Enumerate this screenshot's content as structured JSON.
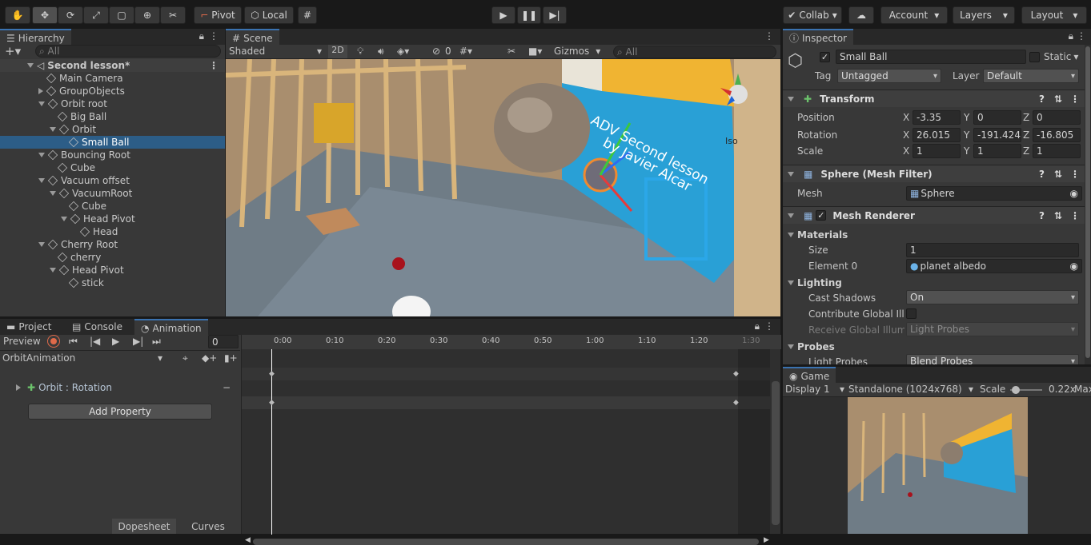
{
  "toolbar": {
    "tools": [
      "hand-tool",
      "move-tool",
      "rotate-tool",
      "scale-tool",
      "rect-tool",
      "transform-tool",
      "custom-tool"
    ],
    "pivot_label": "Pivot",
    "local_label": "Local",
    "collab_label": "Collab",
    "account_label": "Account",
    "layers_label": "Layers",
    "layout_label": "Layout"
  },
  "hierarchy": {
    "tab_label": "Hierarchy",
    "search_placeholder": "All",
    "scene_name": "Second lesson*",
    "items": [
      {
        "label": "Main Camera",
        "depth": 1,
        "arrow": "none"
      },
      {
        "label": "GroupObjects",
        "depth": 1,
        "arrow": "right"
      },
      {
        "label": "Orbit root",
        "depth": 1,
        "arrow": "down"
      },
      {
        "label": "Big Ball",
        "depth": 2,
        "arrow": "none"
      },
      {
        "label": "Orbit",
        "depth": 2,
        "arrow": "down"
      },
      {
        "label": "Small Ball",
        "depth": 3,
        "arrow": "none",
        "selected": true
      },
      {
        "label": "Bouncing Root",
        "depth": 1,
        "arrow": "down"
      },
      {
        "label": "Cube",
        "depth": 2,
        "arrow": "none"
      },
      {
        "label": "Vacuum offset",
        "depth": 1,
        "arrow": "down"
      },
      {
        "label": "VacuumRoot",
        "depth": 2,
        "arrow": "down"
      },
      {
        "label": "Cube",
        "depth": 3,
        "arrow": "none"
      },
      {
        "label": "Head Pivot",
        "depth": 3,
        "arrow": "down"
      },
      {
        "label": "Head",
        "depth": 4,
        "arrow": "none"
      },
      {
        "label": "Cherry Root",
        "depth": 1,
        "arrow": "down"
      },
      {
        "label": "cherry",
        "depth": 2,
        "arrow": "none"
      },
      {
        "label": "Head Pivot",
        "depth": 2,
        "arrow": "down"
      },
      {
        "label": "stick",
        "depth": 3,
        "arrow": "none"
      }
    ]
  },
  "scene": {
    "tab_label": "Scene",
    "shading_mode": "Shaded",
    "mode_2d": "2D",
    "hidden_count": "0",
    "gizmos_label": "Gizmos",
    "search_placeholder": "All",
    "view_label": "Iso",
    "banner_text_1": "ADV Second lesson",
    "banner_text_2": "by Javier Alcar"
  },
  "inspector": {
    "tab_label": "Inspector",
    "object_name": "Small Ball",
    "static_label": "Static",
    "tag_label": "Tag",
    "tag_value": "Untagged",
    "layer_label": "Layer",
    "layer_value": "Default",
    "transform": {
      "title": "Transform",
      "position_label": "Position",
      "rotation_label": "Rotation",
      "scale_label": "Scale",
      "position": {
        "x": "-3.35",
        "y": "0",
        "z": "0"
      },
      "rotation": {
        "x": "26.015",
        "y": "-191.424",
        "z": "-16.805"
      },
      "scale": {
        "x": "1",
        "y": "1",
        "z": "1"
      }
    },
    "mesh_filter": {
      "title": "Sphere (Mesh Filter)",
      "mesh_label": "Mesh",
      "mesh_value": "Sphere"
    },
    "mesh_renderer": {
      "title": "Mesh Renderer",
      "materials_label": "Materials",
      "size_label": "Size",
      "size_value": "1",
      "element0_label": "Element 0",
      "element0_value": "planet albedo",
      "lighting_label": "Lighting",
      "cast_shadows_label": "Cast Shadows",
      "cast_shadows_value": "On",
      "contribute_gi_label": "Contribute Global Illur",
      "receive_gi_label": "Receive Global Illumi",
      "receive_gi_value": "Light Probes",
      "probes_label": "Probes",
      "light_probes_label": "Light Probes",
      "light_probes_value": "Blend Probes"
    }
  },
  "bottom_tabs": {
    "project": "Project",
    "console": "Console",
    "animation": "Animation"
  },
  "animation": {
    "preview_label": "Preview",
    "frame_value": "0",
    "clip_name": "OrbitAnimation",
    "property_label": "Orbit : Rotation",
    "add_property_label": "Add Property",
    "dopesheet_label": "Dopesheet",
    "curves_label": "Curves",
    "ruler": [
      "0:00",
      "0:10",
      "0:20",
      "0:30",
      "0:40",
      "0:50",
      "1:00",
      "1:10",
      "1:20",
      "1:30"
    ]
  },
  "game": {
    "tab_label": "Game",
    "display_value": "Display 1",
    "resolution_value": "Standalone (1024x768)",
    "scale_label": "Scale",
    "scale_value": "0.22x",
    "maximize_label": "Max"
  },
  "colors": {
    "accent": "#3a72b0",
    "selection": "#2c5d87",
    "record": "#e06a4a"
  }
}
